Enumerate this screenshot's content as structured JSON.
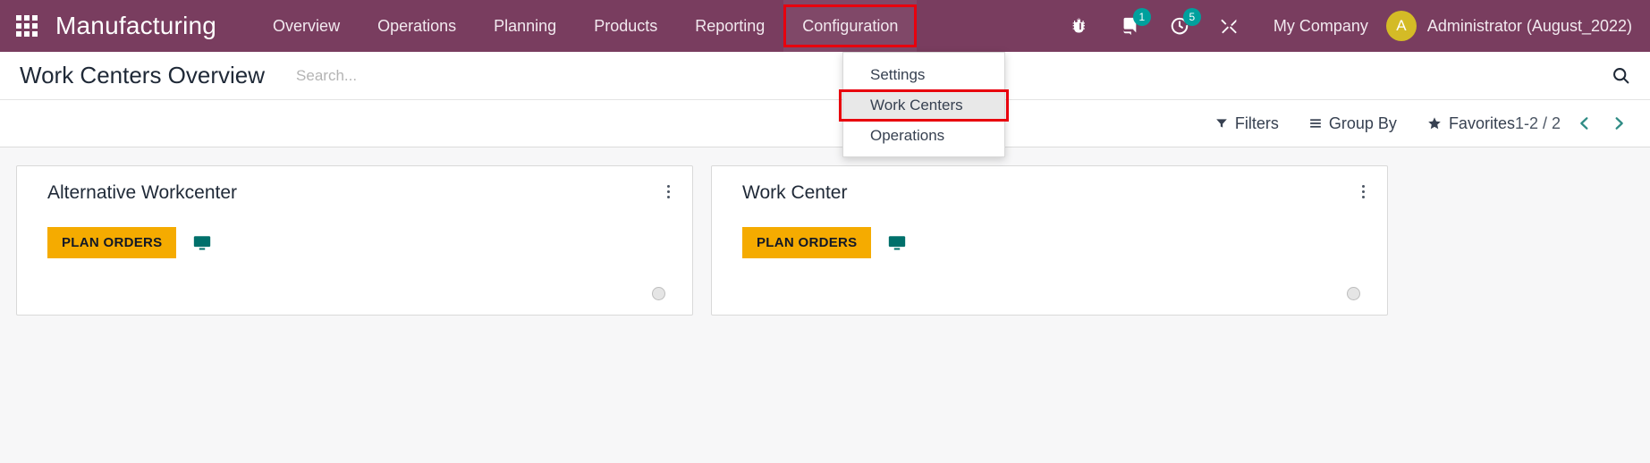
{
  "navbar": {
    "apps_icon": "apps-grid-icon",
    "brand": "Manufacturing",
    "menu_items": [
      {
        "label": "Overview",
        "highlighted": false
      },
      {
        "label": "Operations",
        "highlighted": false
      },
      {
        "label": "Planning",
        "highlighted": false
      },
      {
        "label": "Products",
        "highlighted": false
      },
      {
        "label": "Reporting",
        "highlighted": false
      },
      {
        "label": "Configuration",
        "highlighted": true
      }
    ],
    "icons": {
      "debug": "bug-icon",
      "messages": "chat-bubble-icon",
      "activities": "clock-icon",
      "tools": "wrench-icon"
    },
    "badges": {
      "messages_count": "1",
      "activities_count": "5"
    },
    "company": "My Company",
    "user": {
      "initial": "A",
      "name": "Administrator (August_2022)",
      "avatar_color": "#d4bb26"
    }
  },
  "dropdown": {
    "open": true,
    "items": [
      {
        "label": "Settings",
        "active": false
      },
      {
        "label": "Work Centers",
        "active": true
      },
      {
        "label": "Operations",
        "active": false
      }
    ]
  },
  "control_panel": {
    "title": "Work Centers Overview",
    "search": {
      "placeholder": "Search...",
      "value": "",
      "icon": "search-icon"
    },
    "filters": [
      {
        "label": "Filters",
        "icon": "filter-funnel-icon"
      },
      {
        "label": "Group By",
        "icon": "bars-icon"
      },
      {
        "label": "Favorites",
        "icon": "star-icon"
      }
    ],
    "pager": {
      "range": "1-2 / 2",
      "prev_icon": "chevron-left-icon",
      "next_icon": "chevron-right-icon"
    }
  },
  "kanban": {
    "cards": [
      {
        "title": "Alternative Workcenter",
        "action_label": "PLAN ORDERS",
        "monitor_icon": "monitor-screen-icon",
        "menu_icon": "vertical-dots-icon",
        "status": "idle"
      },
      {
        "title": "Work Center",
        "action_label": "PLAN ORDERS",
        "monitor_icon": "monitor-screen-icon",
        "menu_icon": "vertical-dots-icon",
        "status": "idle"
      }
    ]
  },
  "colors": {
    "navbar_bg": "#793d5f",
    "accent_teal": "#00a09d",
    "highlight_red": "#e8000d",
    "action_orange": "#f5ab00",
    "avatar_yellow": "#d4bb26"
  }
}
